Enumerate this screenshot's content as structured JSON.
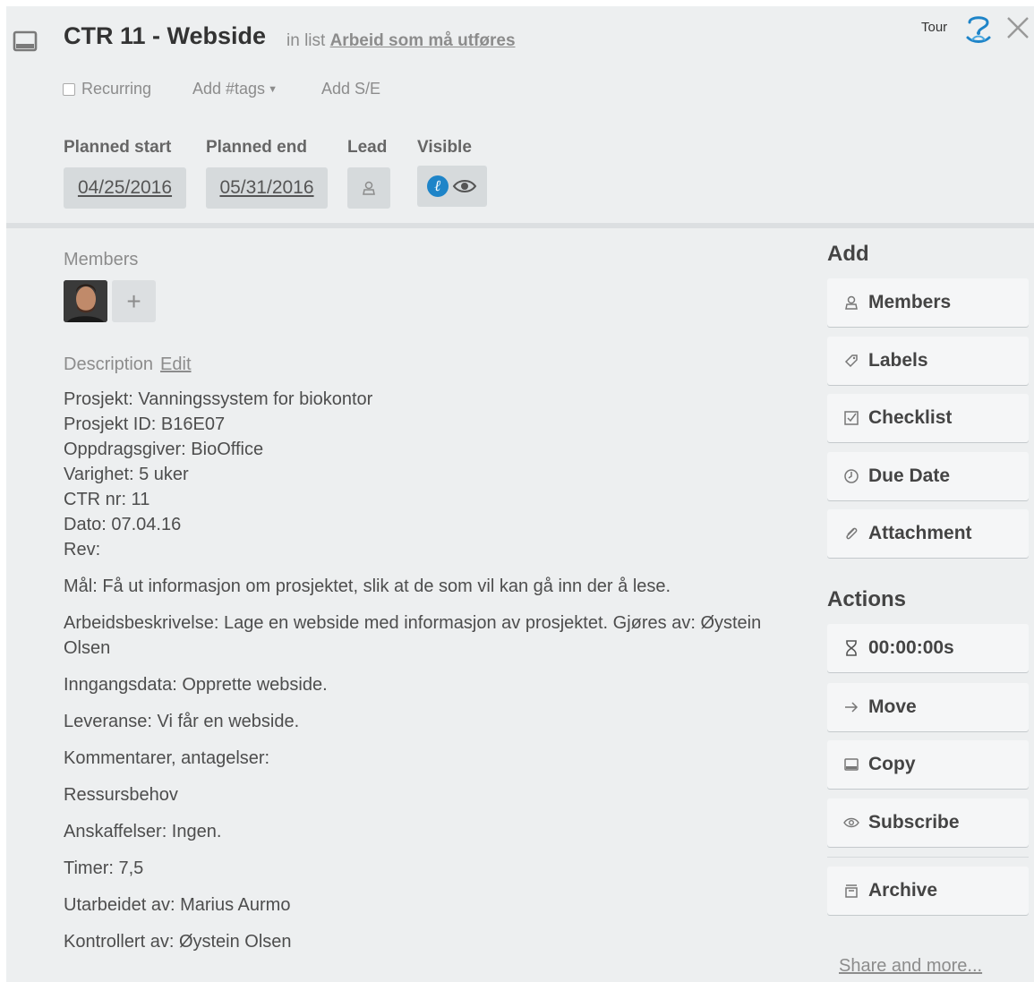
{
  "card": {
    "title": "CTR 11 - Webside",
    "in_list_prefix": "in list",
    "list_name": "Arbeid som må utføres"
  },
  "header": {
    "tour_label": "Tour",
    "recurring_label": "Recurring",
    "recurring_checked": false,
    "tags_label": "Add #tags",
    "addse_label": "Add S/E"
  },
  "fields": {
    "planned_start_label": "Planned start",
    "planned_start_value": "04/25/2016",
    "planned_end_label": "Planned end",
    "planned_end_value": "05/31/2016",
    "lead_label": "Lead",
    "visible_label": "Visible"
  },
  "members": {
    "label": "Members",
    "add_symbol": "+"
  },
  "description": {
    "label": "Description",
    "edit_label": "Edit",
    "header_lines": [
      "Prosjekt: Vanningssystem for biokontor",
      "Prosjekt ID: B16E07",
      "Oppdragsgiver: BioOffice",
      "Varighet: 5 uker",
      "CTR nr: 11",
      "Dato: 07.04.16",
      "Rev:"
    ],
    "paragraphs": [
      "Mål: Få ut informasjon om prosjektet, slik at de som vil kan gå inn der å lese.",
      "Arbeidsbeskrivelse: Lage en webside med informasjon av prosjektet. Gjøres av: Øystein Olsen",
      "Inngangsdata: Opprette webside.",
      "Leveranse: Vi får en webside.",
      "Kommentarer, antagelser:",
      "Ressursbehov",
      "Anskaffelser: Ingen.",
      "Timer: 7,5",
      "Utarbeidet av: Marius Aurmo",
      "Kontrollert av: Øystein Olsen"
    ]
  },
  "sidebar": {
    "add_heading": "Add",
    "add_buttons": [
      {
        "label": "Members",
        "icon": "person-icon"
      },
      {
        "label": "Labels",
        "icon": "tag-icon"
      },
      {
        "label": "Checklist",
        "icon": "checkbox-icon"
      },
      {
        "label": "Due Date",
        "icon": "clock-icon"
      },
      {
        "label": "Attachment",
        "icon": "paperclip-icon"
      }
    ],
    "actions_heading": "Actions",
    "action_buttons": [
      {
        "label": "00:00:00s",
        "icon": "hourglass-icon"
      },
      {
        "label": "Move",
        "icon": "arrow-right-icon"
      },
      {
        "label": "Copy",
        "icon": "card-icon"
      },
      {
        "label": "Subscribe",
        "icon": "eye-icon"
      },
      {
        "label": "Archive",
        "icon": "archive-icon"
      }
    ],
    "share_label": "Share and more..."
  },
  "colors": {
    "panel_bg": "#edeff0",
    "button_bg": "#f5f6f7",
    "date_box_bg": "#d6dadc",
    "visibility_badge": "#1e84c8"
  }
}
